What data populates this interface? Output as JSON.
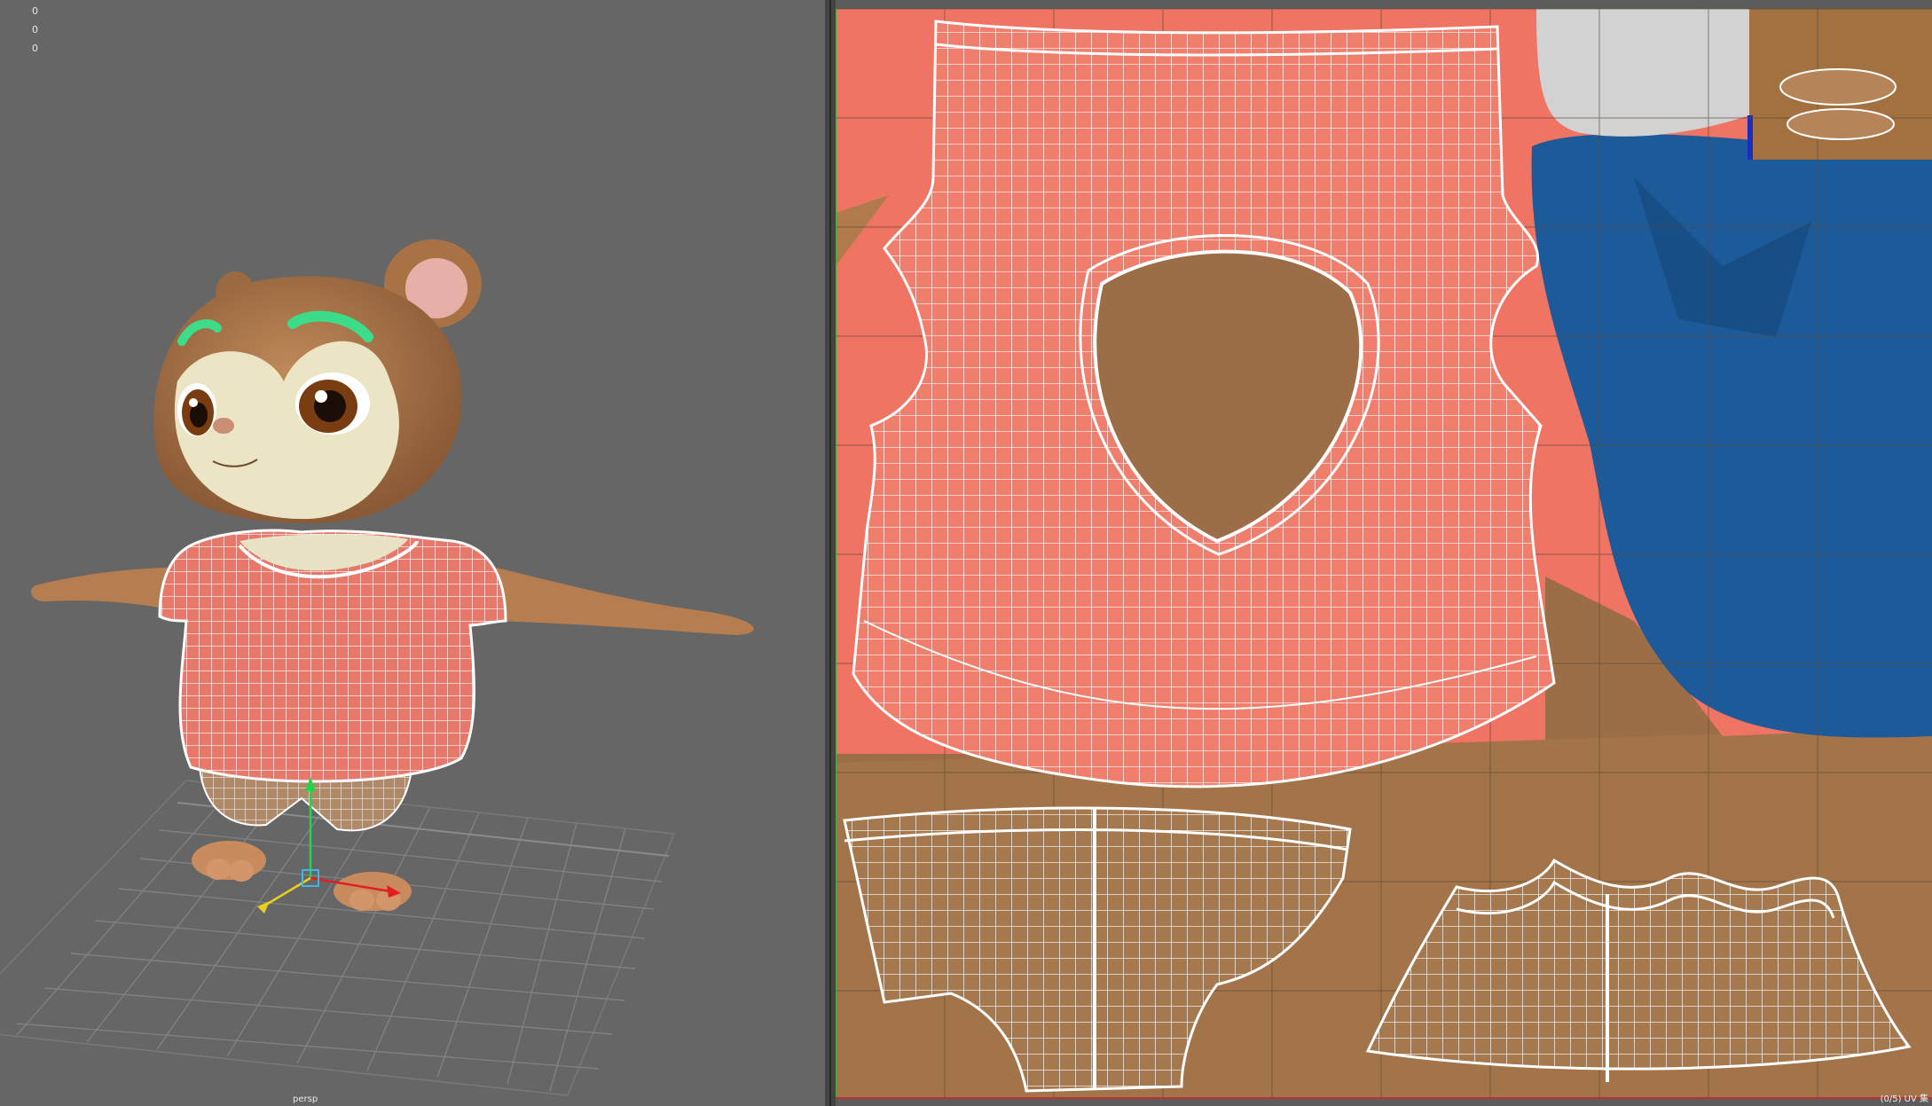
{
  "viewport": {
    "camera": "persp",
    "hud_values": [
      "0",
      "0",
      "0"
    ]
  },
  "uv_editor": {
    "status": "(0/5) UV 集"
  },
  "colors": {
    "viewport_bg": "#666666",
    "uv_bg": "#5c5c5c",
    "shirt": "#e8786a",
    "fur": "#b07d50",
    "blue": "#1d5a9a",
    "wire": "#ffffff"
  }
}
